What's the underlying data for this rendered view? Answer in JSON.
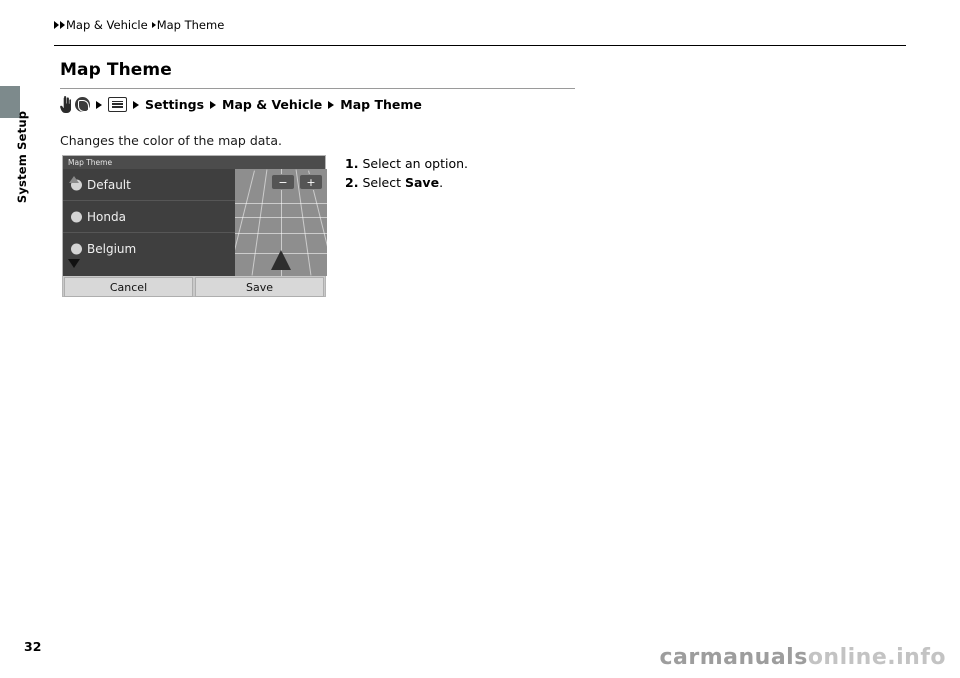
{
  "document": {
    "page_number": "32",
    "section_label": "System Setup",
    "watermark_dark": "carmanuals",
    "watermark_light": "online.info"
  },
  "breadcrumb": {
    "items": [
      "Map & Vehicle",
      "Map Theme"
    ]
  },
  "title": "Map Theme",
  "navpath": {
    "icons": [
      "hand-icon",
      "globe-icon",
      "list-icon"
    ],
    "items": [
      "Settings",
      "Map & Vehicle",
      "Map Theme"
    ]
  },
  "description": "Changes the color of the map data.",
  "steps": [
    {
      "num": "1.",
      "text": "Select an option.",
      "strong": ""
    },
    {
      "num": "2.",
      "text": "Select ",
      "strong": "Save",
      "after": "."
    }
  ],
  "figure": {
    "titlebar": "Map Theme",
    "options": [
      "Default",
      "Honda",
      "Belgium"
    ],
    "zoom_out": "−",
    "zoom_in": "+",
    "buttons": [
      "Cancel",
      "Save"
    ]
  }
}
